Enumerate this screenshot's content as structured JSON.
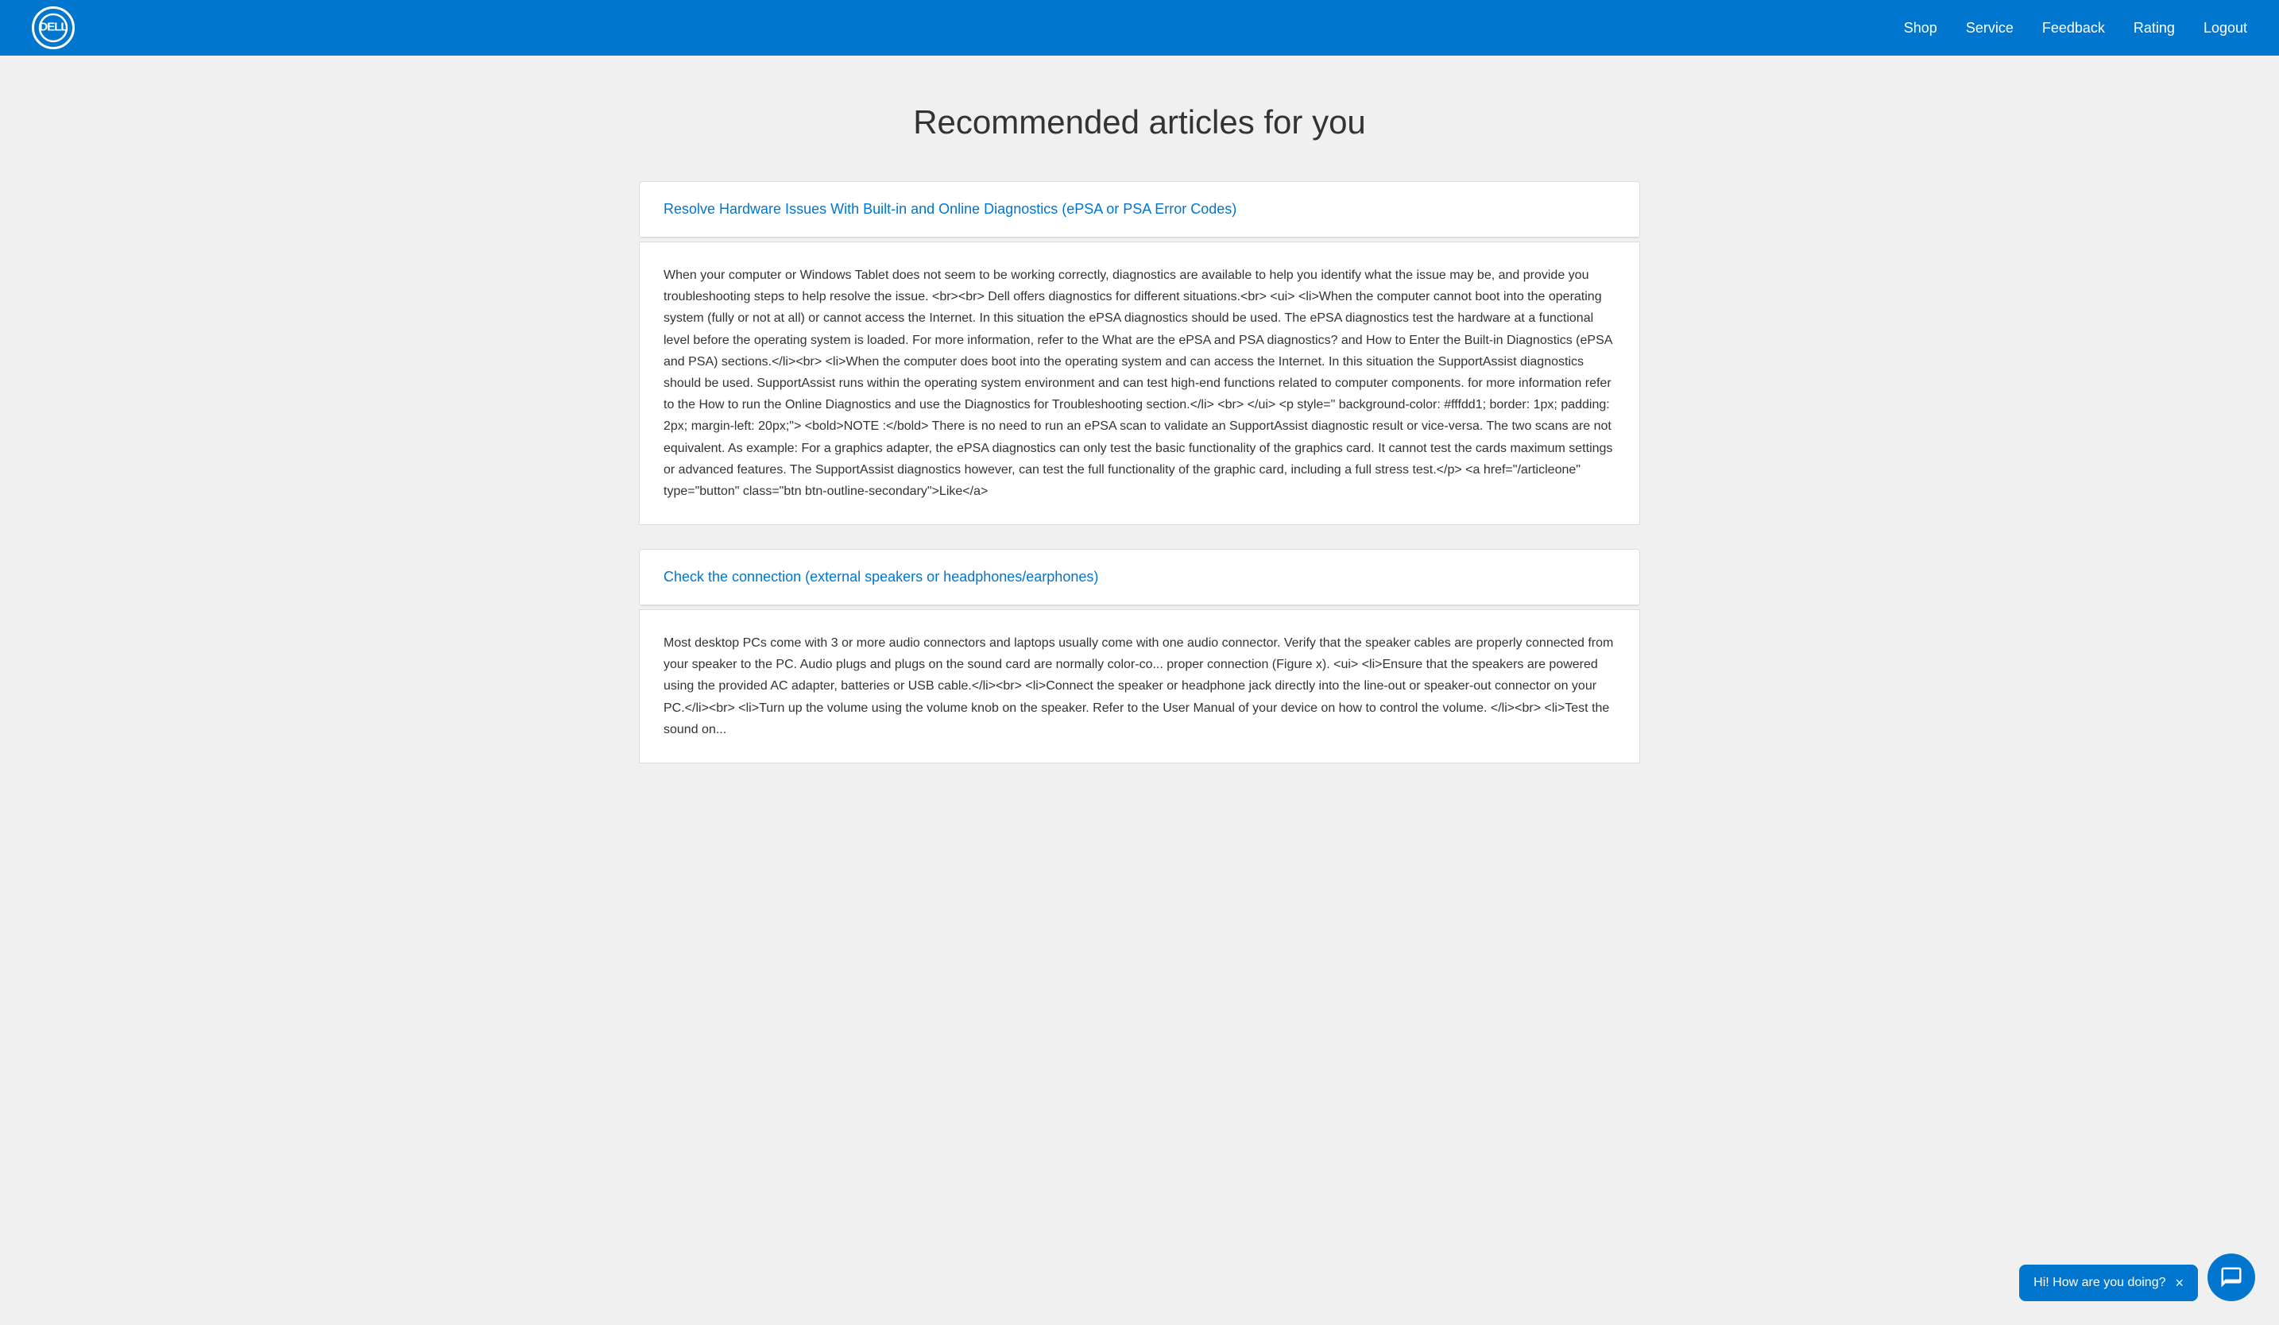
{
  "header": {
    "logo_text": "DELL",
    "nav_items": [
      {
        "label": "Shop",
        "href": "#"
      },
      {
        "label": "Service",
        "href": "#"
      },
      {
        "label": "Feedback",
        "href": "#"
      },
      {
        "label": "Rating",
        "href": "#"
      },
      {
        "label": "Logout",
        "href": "#"
      }
    ]
  },
  "page": {
    "title": "Recommended articles for you"
  },
  "articles": [
    {
      "id": "article-1",
      "title": "Resolve Hardware Issues With Built-in and Online Diagnostics (ePSA or PSA Error Codes)",
      "title_href": "#",
      "body": "When your computer or Windows Tablet does not seem to be working correctly, diagnostics are available to help you identify what the issue may be, and provide you troubleshooting steps to help resolve the issue. <br><br> Dell offers diagnostics for different situations.<br> <ui> <li>When the computer cannot boot into the operating system (fully or not at all) or cannot access the Internet. In this situation the ePSA diagnostics should be used. The ePSA diagnostics test the hardware at a functional level before the operating system is loaded. For more information, refer to the What are the ePSA and PSA diagnostics? and How to Enter the Built-in Diagnostics (ePSA and PSA) sections.</li><br> <li>When the computer does boot into the operating system and can access the Internet. In this situation the SupportAssist diagnostics should be used. SupportAssist runs within the operating system environment and can test high-end functions related to computer components. for more information refer to the How to run the Online Diagnostics and use the Diagnostics for Troubleshooting section.</li> <br> </ui> <p style=\" background-color: #fffdd1; border: 1px; padding: 2px; margin-left: 20px;\"> <bold>NOTE :</bold> There is no need to run an ePSA scan to validate an SupportAssist diagnostic result or vice-versa. The two scans are not equivalent. As example: For a graphics adapter, the ePSA diagnostics can only test the basic functionality of the graphics card. It cannot test the cards maximum settings or advanced features. The SupportAssist diagnostics however, can test the full functionality of the graphic card, including a full stress test.</p> <a href=\"/articleone\" type=\"button\" class=\"btn btn-outline-secondary\">Like</a>"
    },
    {
      "id": "article-2",
      "title": "Check the connection (external speakers or headphones/earphones)",
      "title_href": "#",
      "body": "Most desktop PCs come with 3 or more audio connectors and laptops usually come with one audio connector. Verify that the speaker cables are properly connected from your speaker to the PC. Audio plugs and plugs on the sound card are normally color-co... proper connection (Figure x). <ui> <li>Ensure that the speakers are powered using the provided AC adapter, batteries or USB cable.</li><br> <li>Connect the speaker or headphone jack directly into the line-out or speaker-out connector on your PC.</li><br> <li>Turn up the volume using the volume knob on the speaker. Refer to the User Manual of your device on how to control the volume. </li><br> <li>Test the sound on..."
    }
  ],
  "chat": {
    "popup_text": "Hi! How are you doing?",
    "close_label": "×",
    "icon_aria": "chat-button"
  }
}
